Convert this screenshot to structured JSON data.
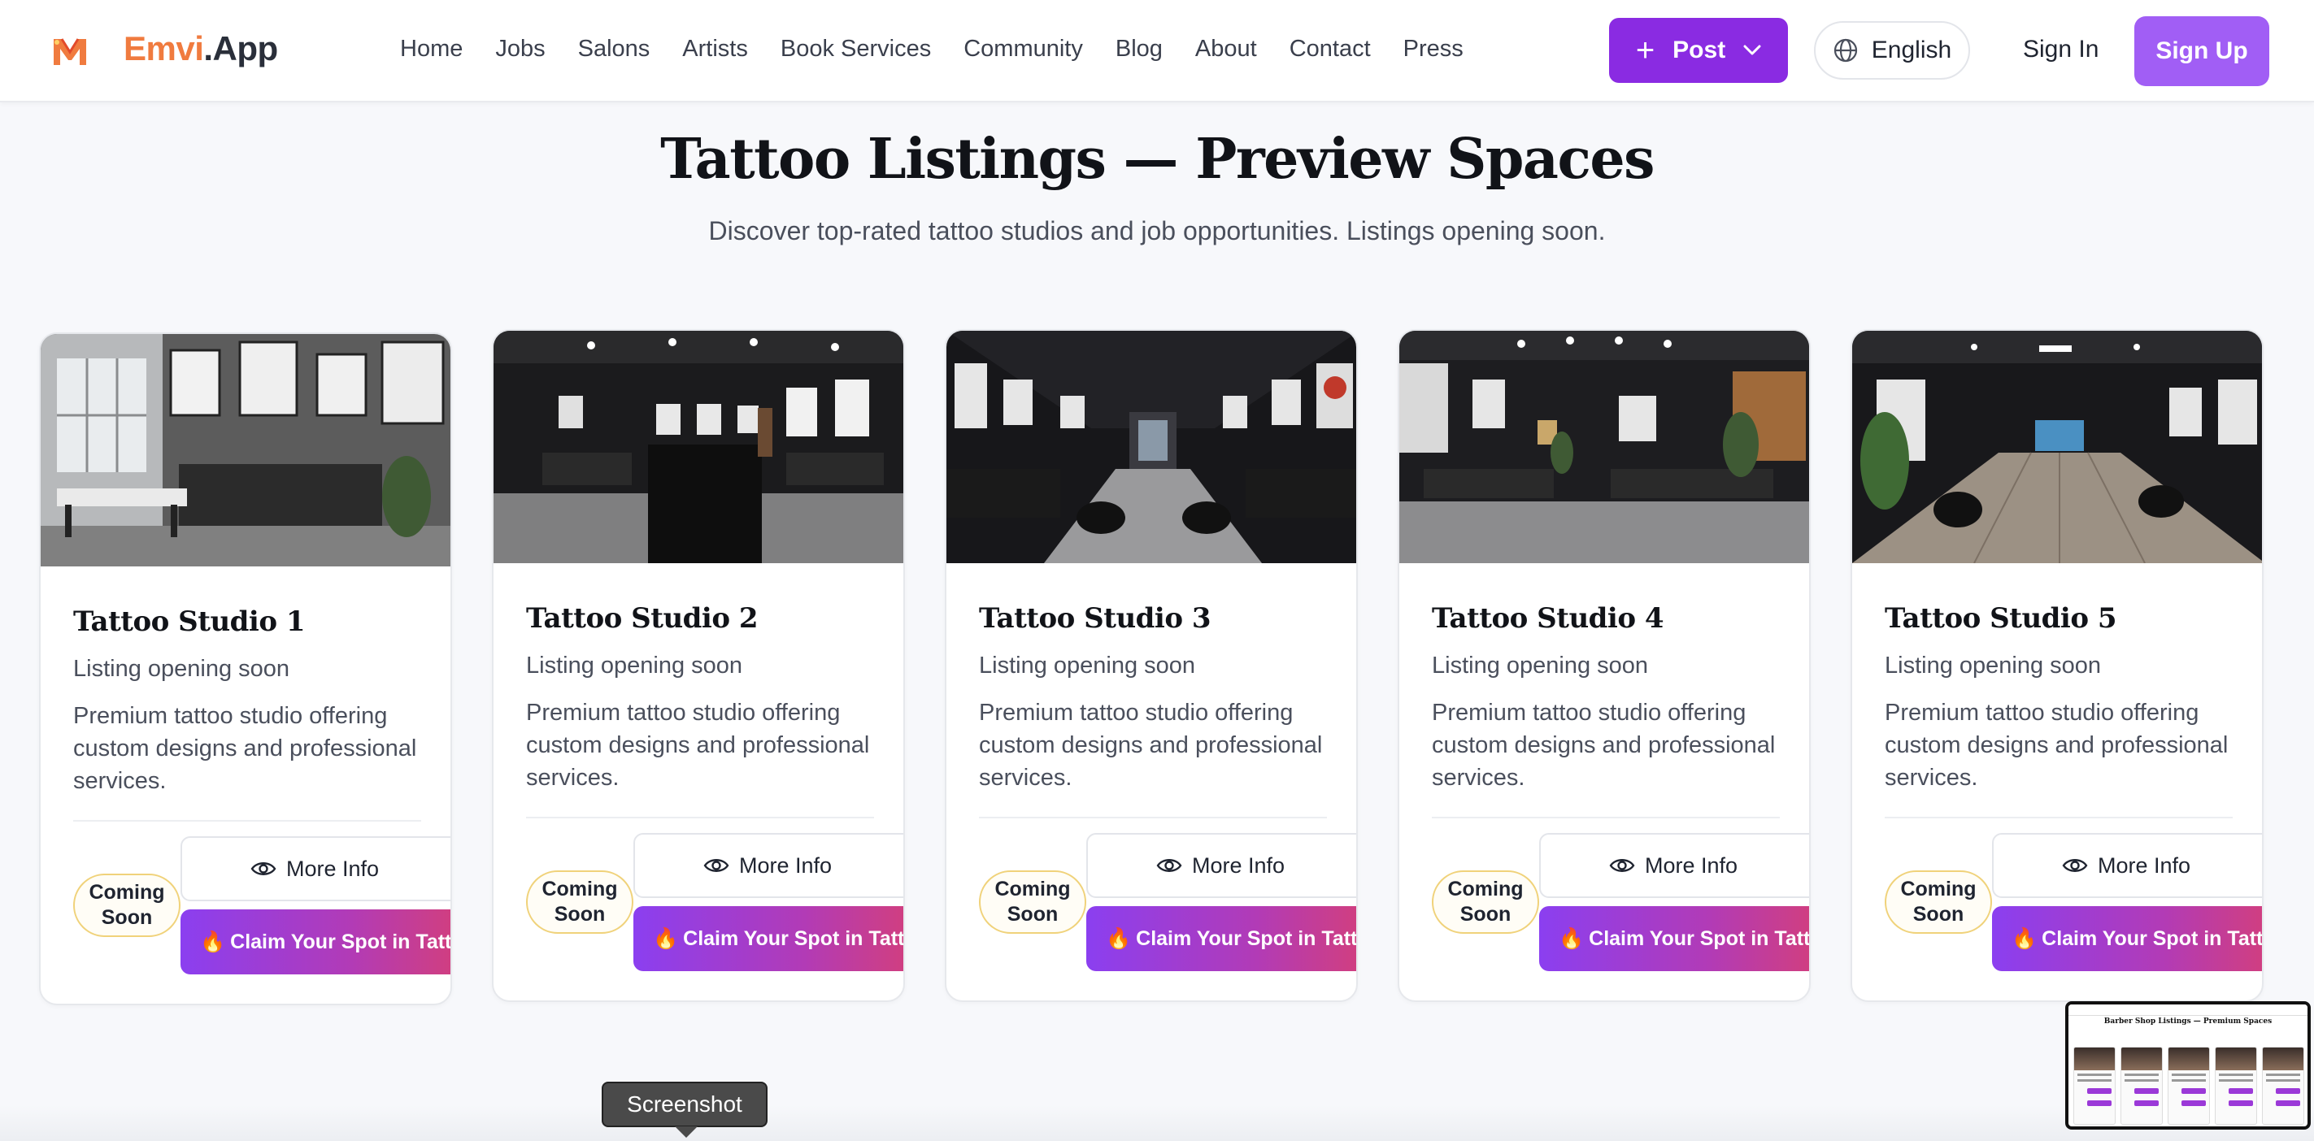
{
  "nav": {
    "brand_part1": "Emvi",
    "brand_part2": ".App",
    "links": [
      "Home",
      "Jobs",
      "Salons",
      "Artists",
      "Book Services",
      "Community",
      "Blog",
      "About",
      "Contact",
      "Press"
    ],
    "post_label": "Post",
    "language_label": "English",
    "signin_label": "Sign In",
    "signup_label": "Sign Up"
  },
  "header": {
    "title": "Tattoo Listings — Preview Spaces",
    "subtitle": "Discover top-rated tattoo studios and job opportunities. Listings opening soon."
  },
  "cards": [
    {
      "title": "Tattoo Studio 1",
      "status": "Listing opening soon",
      "description": "Premium tattoo studio offering custom designs and professional services.",
      "badge": "Coming Soon",
      "more_label": "More Info",
      "claim_label": "Claim Your Spot in Tattoo"
    },
    {
      "title": "Tattoo Studio 2",
      "status": "Listing opening soon",
      "description": "Premium tattoo studio offering custom designs and professional services.",
      "badge": "Coming Soon",
      "more_label": "More Info",
      "claim_label": "Claim Your Spot in Tattoo"
    },
    {
      "title": "Tattoo Studio 3",
      "status": "Listing opening soon",
      "description": "Premium tattoo studio offering custom designs and professional services.",
      "badge": "Coming Soon",
      "more_label": "More Info",
      "claim_label": "Claim Your Spot in Tattoo"
    },
    {
      "title": "Tattoo Studio 4",
      "status": "Listing opening soon",
      "description": "Premium tattoo studio offering custom designs and professional services.",
      "badge": "Coming Soon",
      "more_label": "More Info",
      "claim_label": "Claim Your Spot in Tattoo"
    },
    {
      "title": "Tattoo Studio 5",
      "status": "Listing opening soon",
      "description": "Premium tattoo studio offering custom designs and professional services.",
      "badge": "Coming Soon",
      "more_label": "More Info",
      "claim_label": "Claim Your Spot in Tattoo"
    }
  ],
  "tooltip": {
    "label": "Screenshot"
  },
  "thumbnail": {
    "title": "Barber Shop Listings — Premium Spaces"
  },
  "colors": {
    "brand_orange": "#f07b3f",
    "primary_purple": "#8a2be2",
    "signup_purple": "#a15ef5",
    "claim_gradient_start": "#8b3ff0",
    "claim_gradient_end": "#d43f7a",
    "badge_border": "#f0d27a"
  },
  "icons": {
    "post": "plus-icon",
    "post_menu": "chevron-down-icon",
    "language": "globe-icon",
    "more_info": "eye-icon",
    "claim": "fire-icon"
  }
}
